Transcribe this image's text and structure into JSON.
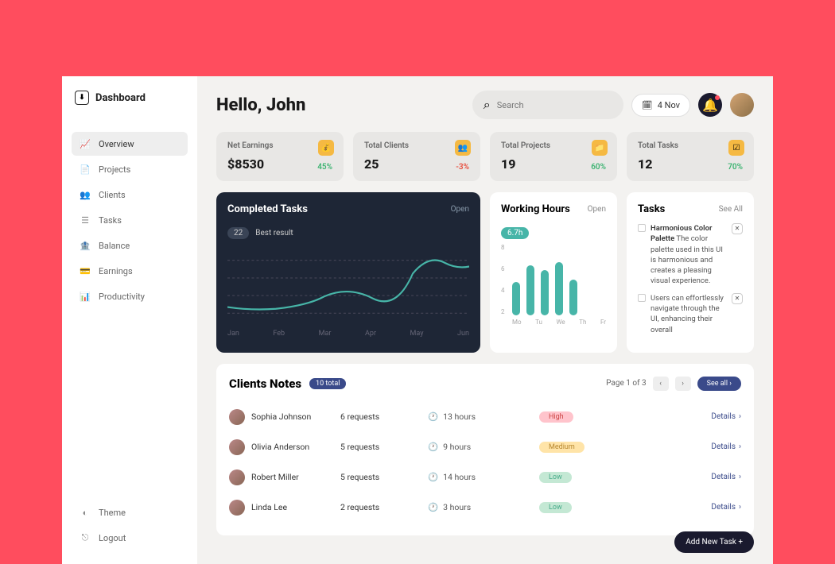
{
  "app_name": "Dashboard",
  "greeting": "Hello, John",
  "search": {
    "placeholder": "Search"
  },
  "date": "4 Nov",
  "sidebar": {
    "items": [
      {
        "label": "Overview",
        "icon": "chart"
      },
      {
        "label": "Projects",
        "icon": "file"
      },
      {
        "label": "Clients",
        "icon": "users"
      },
      {
        "label": "Tasks",
        "icon": "list"
      },
      {
        "label": "Balance",
        "icon": "wallet"
      },
      {
        "label": "Earnings",
        "icon": "card"
      },
      {
        "label": "Productivity",
        "icon": "bars"
      }
    ],
    "footer": [
      {
        "label": "Theme",
        "icon": "moon"
      },
      {
        "label": "Logout",
        "icon": "exit"
      }
    ]
  },
  "stats": [
    {
      "label": "Net Earnings",
      "value": "$8530",
      "pct": "45%",
      "dir": "up"
    },
    {
      "label": "Total Clients",
      "value": "25",
      "pct": "-3%",
      "dir": "down"
    },
    {
      "label": "Total Projects",
      "value": "19",
      "pct": "60%",
      "dir": "up"
    },
    {
      "label": "Total Tasks",
      "value": "12",
      "pct": "70%",
      "dir": "up"
    }
  ],
  "completed": {
    "title": "Completed Tasks",
    "link": "Open",
    "badge_num": "22",
    "badge_text": "Best result"
  },
  "working_hours": {
    "title": "Working Hours",
    "link": "Open",
    "badge": "6.7h"
  },
  "tasks_panel": {
    "title": "Tasks",
    "link": "See All",
    "items": [
      {
        "title": "Harmonious Color Palette",
        "body": "The color palette used in this UI is harmonious and creates a pleasing visual experience."
      },
      {
        "title": "",
        "body": "Users can effortlessly navigate through the UI, enhancing their overall"
      }
    ]
  },
  "notes": {
    "title": "Clients Notes",
    "count": "10 total",
    "page": "Page 1 of 3",
    "see_all": "See all",
    "detailsLabel": "Details",
    "rows": [
      {
        "name": "Sophia Johnson",
        "requests": "6 requests",
        "hours": "13 hours",
        "priority": "High"
      },
      {
        "name": "Olivia Anderson",
        "requests": "5 requests",
        "hours": "9 hours",
        "priority": "Medium"
      },
      {
        "name": "Robert Miller",
        "requests": "5 requests",
        "hours": "14 hours",
        "priority": "Low"
      },
      {
        "name": "Linda Lee",
        "requests": "2 requests",
        "hours": "3 hours",
        "priority": "Low"
      }
    ]
  },
  "fab": "Add New Task +",
  "chart_data": [
    {
      "type": "line",
      "title": "Completed Tasks",
      "x": [
        "Jan",
        "Feb",
        "Mar",
        "Apr",
        "May",
        "Jun"
      ],
      "values": [
        6,
        5,
        9,
        8,
        20,
        18
      ],
      "ylim": [
        0,
        22
      ],
      "best": 22
    },
    {
      "type": "bar",
      "title": "Working Hours",
      "categories": [
        "Mo",
        "Tu",
        "We",
        "Th",
        "Fr"
      ],
      "values": [
        4.2,
        6.2,
        5.6,
        6.7,
        4.5
      ],
      "ylim": [
        0,
        8
      ],
      "yticks": [
        2,
        4,
        6,
        8
      ],
      "average": "6.7h"
    }
  ]
}
